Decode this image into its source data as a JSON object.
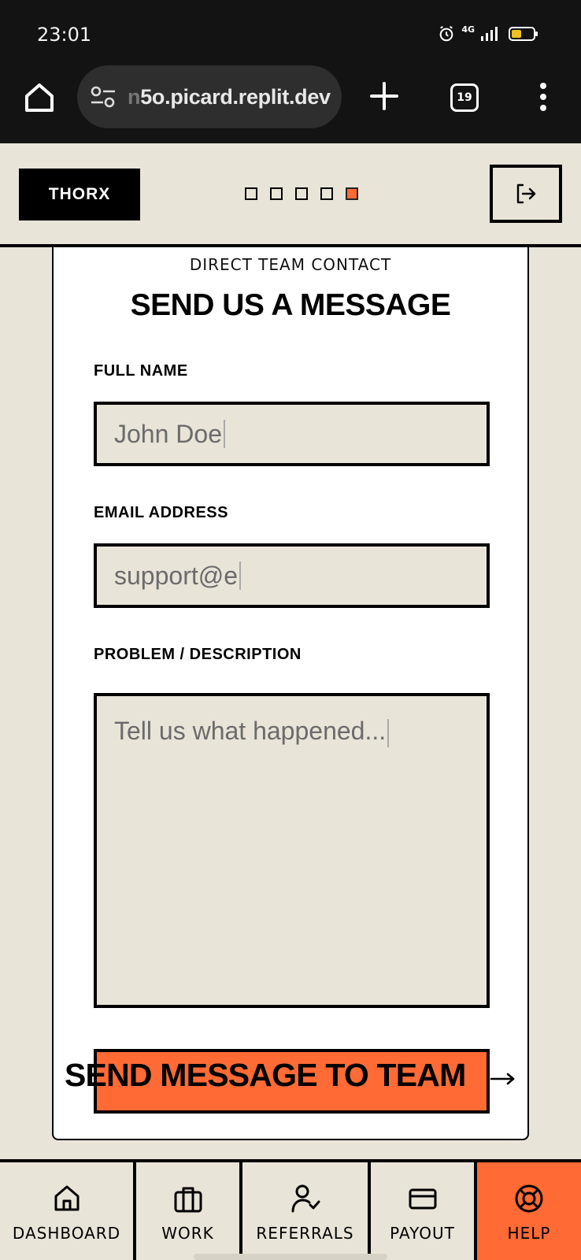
{
  "status_bar": {
    "time": "23:01",
    "network": "4G",
    "battery_color": "#f0c020"
  },
  "browser": {
    "url_faded": "n",
    "url_main": "5o.picard.replit.dev",
    "tab_count": "19"
  },
  "header": {
    "logo": "THORX",
    "progress": {
      "total": 5,
      "active_index": 4
    },
    "accent_color": "#ff6a35"
  },
  "form": {
    "eyebrow": "DIRECT TEAM CONTACT",
    "title": "SEND US A MESSAGE",
    "name_label": "FULL NAME",
    "name_placeholder": "John Doe",
    "email_label": "EMAIL ADDRESS",
    "email_placeholder": "support@e",
    "description_label": "PROBLEM / DESCRIPTION",
    "description_placeholder": "Tell us what happened...",
    "submit_label": "SEND MESSAGE TO TEAM"
  },
  "nav": {
    "items": [
      {
        "label": "DASHBOARD",
        "icon": "home-icon",
        "active": false
      },
      {
        "label": "WORK",
        "icon": "briefcase-icon",
        "active": false
      },
      {
        "label": "REFERRALS",
        "icon": "user-check-icon",
        "active": false
      },
      {
        "label": "PAYOUT",
        "icon": "credit-card-icon",
        "active": false
      },
      {
        "label": "HELP",
        "icon": "life-buoy-icon",
        "active": true
      }
    ]
  }
}
